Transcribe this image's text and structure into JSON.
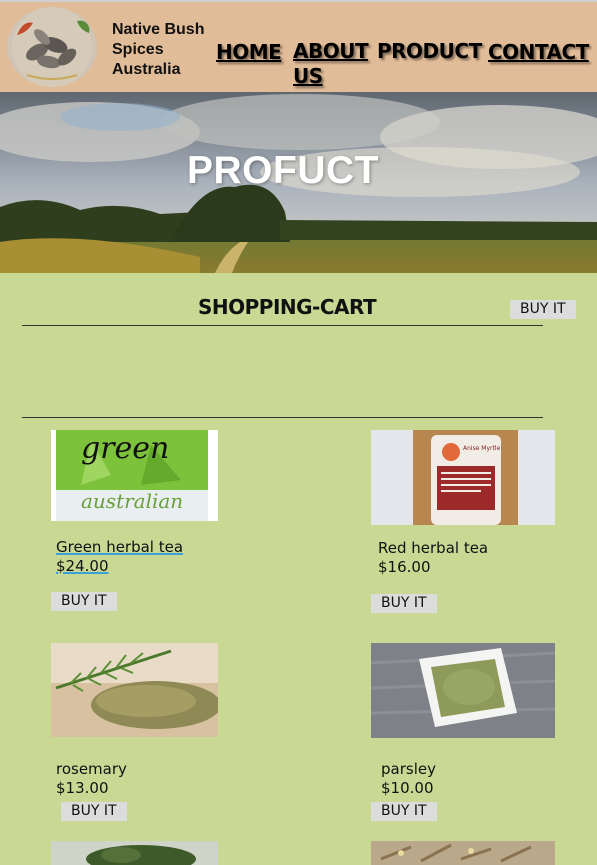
{
  "brand": {
    "line1": "Native Bush",
    "line2": "Spices",
    "line3": "Australia"
  },
  "nav": [
    {
      "label": "HOME"
    },
    {
      "label": "ABOUT US"
    },
    {
      "label": "PRODUCT"
    },
    {
      "label": "CONTACT"
    }
  ],
  "hero": {
    "title": "PROFUCT"
  },
  "cart": {
    "title": "SHOPPING-CART",
    "buy_label": "BUY IT"
  },
  "products": [
    {
      "name": "Green herbal tea",
      "price": "$24.00",
      "buy_label": "BUY IT"
    },
    {
      "name": "Red herbal tea",
      "price": "$16.00",
      "buy_label": "BUY IT"
    },
    {
      "name": "rosemary",
      "price": "$13.00",
      "buy_label": "BUY IT"
    },
    {
      "name": "parsley",
      "price": "$10.00",
      "buy_label": "BUY IT"
    }
  ],
  "colors": {
    "header": "#e1bc98",
    "page": "#c9d994",
    "button": "#dcdcdc"
  }
}
